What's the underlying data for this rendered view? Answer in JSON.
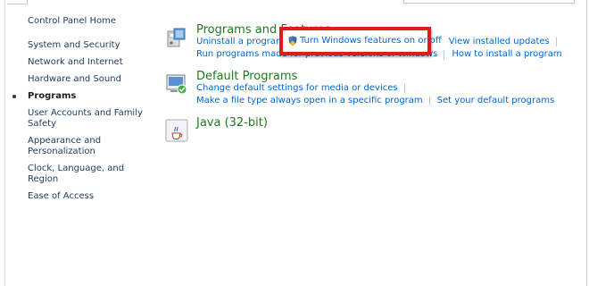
{
  "sidebar": {
    "home": "Control Panel Home",
    "items": [
      "System and Security",
      "Network and Internet",
      "Hardware and Sound",
      "Programs",
      "User Accounts and Family Safety",
      "Appearance and Personalization",
      "Clock, Language, and Region",
      "Ease of Access"
    ],
    "current": "Programs"
  },
  "programs_and_features": {
    "title": "Programs and Features",
    "links": {
      "uninstall": "Uninstall a program",
      "turn_features": "Turn Windows features on or off",
      "view_updates": "View installed updates",
      "run_previous": "Run programs made for previous versions of Windows",
      "how_to_install": "How to install a program"
    },
    "icon": "programs-features-icon"
  },
  "default_programs": {
    "title": "Default Programs",
    "links": {
      "change_defaults": "Change default settings for media or devices",
      "file_type": "Make a file type always open in a specific program",
      "set_defaults": "Set your default programs"
    },
    "icon": "default-programs-icon"
  },
  "java": {
    "title": "Java (32-bit)",
    "icon": "java-icon"
  },
  "colors": {
    "category_title": "#1e7a1e",
    "link": "#0066cc",
    "highlight": "#e01b1b"
  }
}
